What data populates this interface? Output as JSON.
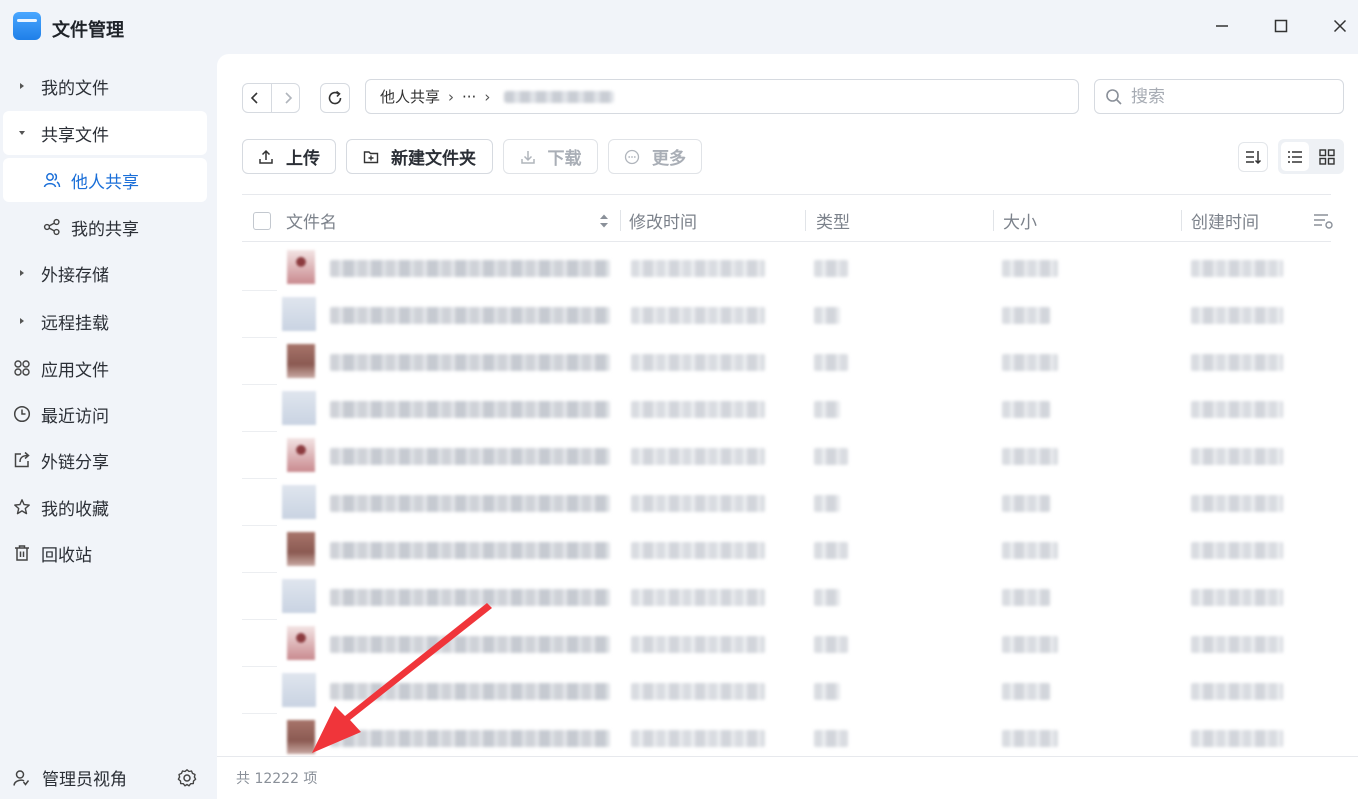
{
  "app": {
    "title": "文件管理"
  },
  "window": {
    "minimize": "—",
    "maximize": "☐",
    "close": "✕"
  },
  "sidebar": {
    "items": [
      {
        "label": "我的文件",
        "icon": "caret-right-icon"
      },
      {
        "label": "共享文件",
        "icon": "caret-down-icon"
      },
      {
        "label": "他人共享",
        "icon": "users-icon"
      },
      {
        "label": "我的共享",
        "icon": "share-icon"
      },
      {
        "label": "外接存储",
        "icon": "caret-right-icon"
      },
      {
        "label": "远程挂载",
        "icon": "caret-right-icon"
      },
      {
        "label": "应用文件",
        "icon": "apps-icon"
      },
      {
        "label": "最近访问",
        "icon": "clock-icon"
      },
      {
        "label": "外链分享",
        "icon": "external-share-icon"
      },
      {
        "label": "我的收藏",
        "icon": "star-icon"
      },
      {
        "label": "回收站",
        "icon": "trash-icon"
      }
    ],
    "footer_label": "管理员视角"
  },
  "path": {
    "root": "他人共享",
    "ellipsis": "···"
  },
  "search": {
    "placeholder": "搜索"
  },
  "toolbar": {
    "upload": "上传",
    "new_folder": "新建文件夹",
    "download": "下载",
    "more": "更多"
  },
  "table": {
    "columns": [
      "文件名",
      "修改时间",
      "类型",
      "大小",
      "创建时间"
    ],
    "row_count_visible": 11
  },
  "status": {
    "total": "共 12222 项"
  },
  "colors": {
    "accent": "#1b6fd8",
    "annotation_arrow": "#f0353a"
  }
}
